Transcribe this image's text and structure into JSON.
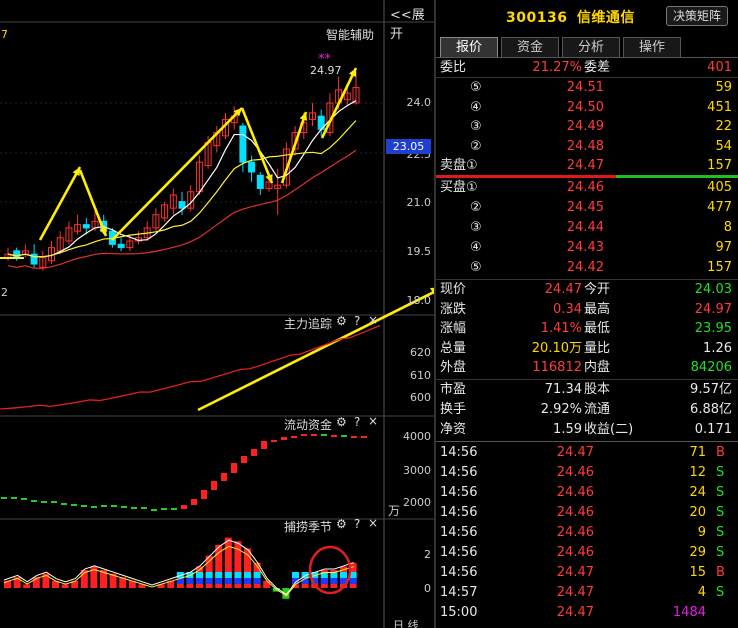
{
  "chart_panel": {
    "expand_label": "<<展开",
    "smart_assist": "智能辅助",
    "stars": "**",
    "high_marker": "24.97",
    "left_edge_top": "7",
    "left_edge_mid": "2",
    "price_axis": [
      "24.0",
      "22.5",
      "21.0",
      "19.5",
      "18.0"
    ],
    "current_price_tag": "23.05",
    "panels": [
      {
        "title": "主力追踪",
        "ticks": [
          "620",
          "610",
          "600"
        ]
      },
      {
        "title": "流动资金",
        "ticks": [
          "4000",
          "3000",
          "2000"
        ],
        "unit": "万"
      },
      {
        "title": "捕捞季节",
        "ticks": [
          "2",
          "0"
        ]
      }
    ],
    "bottom_right": "日 线",
    "settings_icon": "gear-icon",
    "help_glyph": "?",
    "close_glyph": "×"
  },
  "header": {
    "code": "300136",
    "name": "信维通信",
    "decide_button": "决策矩阵"
  },
  "tabs": [
    "报价",
    "资金",
    "分析",
    "操作"
  ],
  "order_book": {
    "weibi_label": "委比",
    "weibi_value": "21.27%",
    "weicha_label": "委差",
    "weicha_value": "401",
    "sells": [
      {
        "label": "⑤",
        "price": "24.51",
        "vol": "59"
      },
      {
        "label": "④",
        "price": "24.50",
        "vol": "451"
      },
      {
        "label": "③",
        "price": "24.49",
        "vol": "22"
      },
      {
        "label": "②",
        "price": "24.48",
        "vol": "54"
      },
      {
        "label": "卖盘①",
        "price": "24.47",
        "vol": "157"
      }
    ],
    "buys": [
      {
        "label": "买盘①",
        "price": "24.46",
        "vol": "405"
      },
      {
        "label": "②",
        "price": "24.45",
        "vol": "477"
      },
      {
        "label": "③",
        "price": "24.44",
        "vol": "8"
      },
      {
        "label": "④",
        "price": "24.43",
        "vol": "97"
      },
      {
        "label": "⑤",
        "price": "24.42",
        "vol": "157"
      }
    ],
    "buy_strength": 0.58
  },
  "stats": [
    {
      "l1": "现价",
      "v1": "24.47",
      "c1": "red",
      "l2": "今开",
      "v2": "24.03",
      "c2": "green"
    },
    {
      "l1": "涨跌",
      "v1": "0.34",
      "c1": "red",
      "l2": "最高",
      "v2": "24.97",
      "c2": "red"
    },
    {
      "l1": "涨幅",
      "v1": "1.41%",
      "c1": "red",
      "l2": "最低",
      "v2": "23.95",
      "c2": "green"
    },
    {
      "l1": "总量",
      "v1": "20.10万",
      "c1": "yellow",
      "l2": "量比",
      "v2": "1.26",
      "c2": "white"
    },
    {
      "l1": "外盘",
      "v1": "116812",
      "c1": "red",
      "l2": "内盘",
      "v2": "84206",
      "c2": "green"
    }
  ],
  "stats2": [
    {
      "l1": "市盈",
      "v1": "71.34",
      "l2": "股本",
      "v2": "9.57亿"
    },
    {
      "l1": "换手",
      "v1": "2.92%",
      "l2": "流通",
      "v2": "6.88亿"
    },
    {
      "l1": "净资",
      "v1": "1.59",
      "l2": "收益(二)",
      "v2": "0.171"
    }
  ],
  "ticks": [
    {
      "time": "14:56",
      "price": "24.47",
      "vol": "71",
      "side": "B"
    },
    {
      "time": "14:56",
      "price": "24.46",
      "vol": "12",
      "side": "S"
    },
    {
      "time": "14:56",
      "price": "24.46",
      "vol": "24",
      "side": "S"
    },
    {
      "time": "14:56",
      "price": "24.46",
      "vol": "20",
      "side": "S"
    },
    {
      "time": "14:56",
      "price": "24.46",
      "vol": "9",
      "side": "S"
    },
    {
      "time": "14:56",
      "price": "24.46",
      "vol": "29",
      "side": "S"
    },
    {
      "time": "14:56",
      "price": "24.47",
      "vol": "15",
      "side": "B"
    },
    {
      "time": "14:57",
      "price": "24.47",
      "vol": "4",
      "side": "S"
    },
    {
      "time": "15:00",
      "price": "24.47",
      "vol": "1484",
      "side": ""
    }
  ],
  "chart_data": {
    "type": "candlestick",
    "price_axis_ticks": [
      24.0,
      22.5,
      21.0,
      19.5,
      18.0
    ],
    "current_price": 23.05,
    "high_marker": 24.97,
    "candles": [
      {
        "o": 19.3,
        "c": 19.4,
        "h": 19.6,
        "l": 19.2
      },
      {
        "o": 19.5,
        "c": 19.3,
        "h": 19.6,
        "l": 19.2
      },
      {
        "o": 19.4,
        "c": 19.5,
        "h": 19.7,
        "l": 19.3
      },
      {
        "o": 19.4,
        "c": 19.1,
        "h": 19.7,
        "l": 19.0
      },
      {
        "o": 19.0,
        "c": 19.3,
        "h": 19.5,
        "l": 18.9
      },
      {
        "o": 19.2,
        "c": 19.6,
        "h": 19.8,
        "l": 19.1
      },
      {
        "o": 19.5,
        "c": 19.9,
        "h": 20.1,
        "l": 19.4
      },
      {
        "o": 19.8,
        "c": 20.2,
        "h": 20.4,
        "l": 19.7
      },
      {
        "o": 20.1,
        "c": 20.3,
        "h": 20.6,
        "l": 20.0
      },
      {
        "o": 20.3,
        "c": 20.2,
        "h": 20.5,
        "l": 20.0
      },
      {
        "o": 20.2,
        "c": 20.4,
        "h": 20.7,
        "l": 20.1
      },
      {
        "o": 20.4,
        "c": 20.1,
        "h": 20.6,
        "l": 20.0
      },
      {
        "o": 20.1,
        "c": 19.7,
        "h": 20.2,
        "l": 19.6
      },
      {
        "o": 19.7,
        "c": 19.6,
        "h": 19.9,
        "l": 19.5
      },
      {
        "o": 19.6,
        "c": 19.8,
        "h": 20.0,
        "l": 19.5
      },
      {
        "o": 19.8,
        "c": 19.9,
        "h": 20.1,
        "l": 19.7
      },
      {
        "o": 19.9,
        "c": 20.2,
        "h": 20.4,
        "l": 19.8
      },
      {
        "o": 20.2,
        "c": 20.6,
        "h": 20.8,
        "l": 20.1
      },
      {
        "o": 20.5,
        "c": 20.9,
        "h": 21.0,
        "l": 20.4
      },
      {
        "o": 20.8,
        "c": 21.2,
        "h": 21.4,
        "l": 20.6
      },
      {
        "o": 21.0,
        "c": 20.8,
        "h": 21.3,
        "l": 20.6
      },
      {
        "o": 20.8,
        "c": 21.3,
        "h": 21.5,
        "l": 20.7
      },
      {
        "o": 21.3,
        "c": 22.2,
        "h": 22.4,
        "l": 21.2
      },
      {
        "o": 22.1,
        "c": 22.8,
        "h": 23.0,
        "l": 22.0
      },
      {
        "o": 22.7,
        "c": 23.1,
        "h": 23.3,
        "l": 22.5
      },
      {
        "o": 23.0,
        "c": 23.5,
        "h": 23.7,
        "l": 22.9
      },
      {
        "o": 23.4,
        "c": 23.6,
        "h": 23.9,
        "l": 23.2
      },
      {
        "o": 23.3,
        "c": 22.2,
        "h": 23.4,
        "l": 21.9
      },
      {
        "o": 22.2,
        "c": 21.9,
        "h": 22.4,
        "l": 21.6
      },
      {
        "o": 21.8,
        "c": 21.4,
        "h": 21.9,
        "l": 21.2
      },
      {
        "o": 21.4,
        "c": 21.6,
        "h": 21.8,
        "l": 21.3
      },
      {
        "o": 21.4,
        "c": 21.5,
        "h": 22.0,
        "l": 20.6
      },
      {
        "o": 21.5,
        "c": 22.6,
        "h": 22.8,
        "l": 21.4
      },
      {
        "o": 22.6,
        "c": 23.1,
        "h": 23.3,
        "l": 22.4
      },
      {
        "o": 23.1,
        "c": 23.4,
        "h": 23.7,
        "l": 22.9
      },
      {
        "o": 23.5,
        "c": 23.7,
        "h": 24.0,
        "l": 23.3
      },
      {
        "o": 23.6,
        "c": 23.2,
        "h": 23.8,
        "l": 23.0
      },
      {
        "o": 23.1,
        "c": 24.0,
        "h": 24.3,
        "l": 23.0
      },
      {
        "o": 24.0,
        "c": 24.4,
        "h": 24.8,
        "l": 23.8
      },
      {
        "o": 24.1,
        "c": 24.3,
        "h": 24.6,
        "l": 23.9
      },
      {
        "o": 24.0,
        "c": 24.47,
        "h": 24.97,
        "l": 23.95
      }
    ]
  }
}
